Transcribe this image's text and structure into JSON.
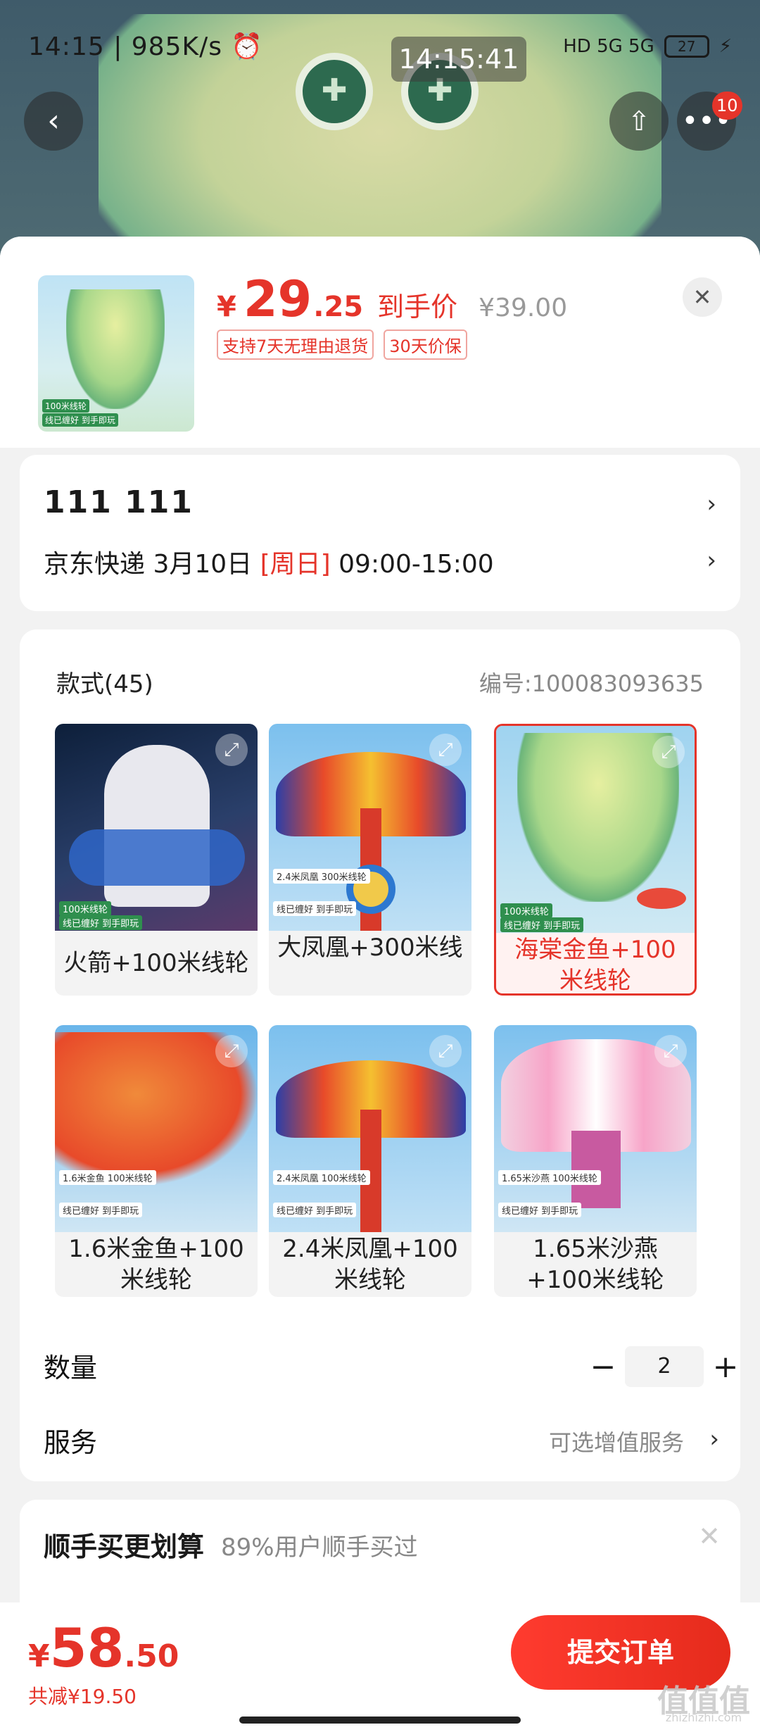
{
  "status_bar": {
    "left": "14:15 | 985K/s ⏰",
    "time_badge": "14:15:41",
    "network": "HD 5G 5G",
    "battery": "27"
  },
  "hero": {
    "back_icon": "‹",
    "share_icon": "⇧",
    "more_icon": "•••",
    "notification_count": "10"
  },
  "product": {
    "price_symbol": "¥",
    "price_int": "29",
    "price_dec": ".25",
    "price_tag": "到手价",
    "original_price": "¥39.00",
    "promo_tags": [
      "支持7天无理由退货",
      "30天价保"
    ],
    "thumb_tags": [
      "100米线轮",
      "线已缠好 到手即玩"
    ],
    "close_icon": "✕"
  },
  "address": {
    "name": "111  111",
    "shipping_prefix": "京东快递 3月10日 ",
    "shipping_day": "[周日]",
    "shipping_time": " 09:00-15:00"
  },
  "spec": {
    "title": "款式(45)",
    "code": "编号:100083093635",
    "options": [
      {
        "label": "火箭+100米线轮",
        "tags": [
          "100米线轮",
          "线已缠好 到手即玩"
        ],
        "selected": false
      },
      {
        "label": "大凤凰+300米线",
        "tags": [
          "2.4米凤凰 300米线轮",
          "线已缠好 到手即玩"
        ],
        "selected": false
      },
      {
        "label": "海棠金鱼+100米线轮",
        "tags": [
          "100米线轮",
          "线已缠好 到手即玩"
        ],
        "selected": true
      },
      {
        "label": "1.6米金鱼+100米线轮",
        "tags": [
          "1.6米金鱼 100米线轮",
          "线已缠好 到手即玩"
        ],
        "selected": false
      },
      {
        "label": "2.4米凤凰+100米线轮",
        "tags": [
          "2.4米凤凰 100米线轮",
          "线已缠好 到手即玩"
        ],
        "selected": false
      },
      {
        "label": "1.65米沙燕+100米线轮",
        "tags": [
          "1.65米沙燕 100米线轮",
          "线已缠好 到手即玩"
        ],
        "selected": false
      }
    ],
    "quantity_label": "数量",
    "quantity_minus": "−",
    "quantity_value": "2",
    "quantity_plus": "+",
    "service_label": "服务",
    "service_hint": "可选增值服务",
    "chevron": "›"
  },
  "bundle": {
    "title": "顺手买更划算",
    "subtitle": "89%用户顺手买过",
    "close_icon": "✕"
  },
  "bottom": {
    "total_symbol": "¥",
    "total_int": "58",
    "total_dec": ".50",
    "saved": "共减¥19.50",
    "submit_label": "提交订单"
  },
  "watermark": {
    "main": "值值值",
    "sub": "zhizhizhi.com"
  },
  "colors": {
    "accent": "#e5342a",
    "selected_bg": "#fff2f1"
  }
}
